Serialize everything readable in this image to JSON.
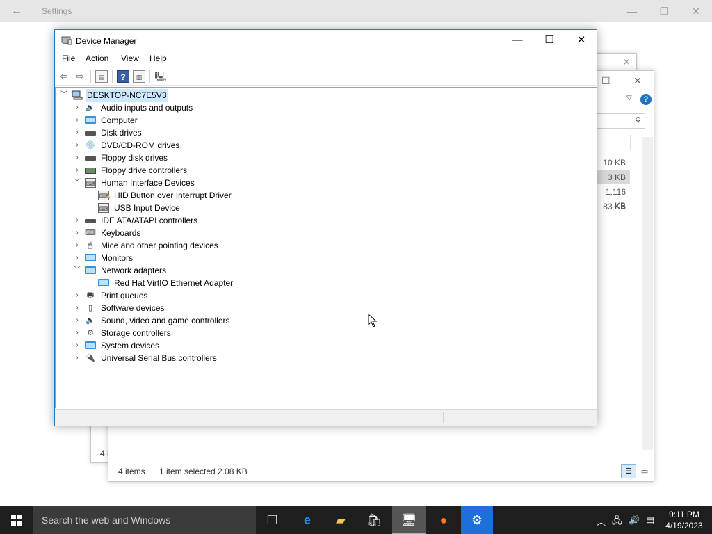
{
  "settings": {
    "title": "Settings"
  },
  "back_window": {
    "corner_text": "4 i"
  },
  "explorer": {
    "sizes": [
      "10 KB",
      "3 KB",
      "1,116 KB",
      "83 KB"
    ],
    "status_items": "4 items",
    "status_selected": "1 item selected  2.08 KB",
    "help_glyph": "?"
  },
  "device_manager": {
    "title": "Device Manager",
    "menu": [
      "File",
      "Action",
      "View",
      "Help"
    ],
    "root": "DESKTOP-NC7E5V3",
    "tree": [
      {
        "label": "Audio inputs and outputs",
        "icon": "speaker-icon",
        "expanded": false,
        "level": 1
      },
      {
        "label": "Computer",
        "icon": "monitor-icon",
        "expanded": false,
        "level": 1
      },
      {
        "label": "Disk drives",
        "icon": "disk-drive-icon",
        "expanded": false,
        "level": 1
      },
      {
        "label": "DVD/CD-ROM drives",
        "icon": "dvd-drive-icon",
        "expanded": false,
        "level": 1
      },
      {
        "label": "Floppy disk drives",
        "icon": "floppy-disk-icon",
        "expanded": false,
        "level": 1
      },
      {
        "label": "Floppy drive controllers",
        "icon": "controller-card-icon",
        "expanded": false,
        "level": 1
      },
      {
        "label": "Human Interface Devices",
        "icon": "hid-icon",
        "expanded": true,
        "level": 1
      },
      {
        "label": "HID Button over Interrupt Driver",
        "icon": "hid-warning-icon",
        "level": 2
      },
      {
        "label": "USB Input Device",
        "icon": "hid-icon",
        "level": 2
      },
      {
        "label": "IDE ATA/ATAPI controllers",
        "icon": "ide-controller-icon",
        "expanded": false,
        "level": 1
      },
      {
        "label": "Keyboards",
        "icon": "keyboard-icon",
        "expanded": false,
        "level": 1
      },
      {
        "label": "Mice and other pointing devices",
        "icon": "mouse-icon",
        "expanded": false,
        "level": 1
      },
      {
        "label": "Monitors",
        "icon": "monitor-icon",
        "expanded": false,
        "level": 1
      },
      {
        "label": "Network adapters",
        "icon": "network-adapter-icon",
        "expanded": true,
        "level": 1
      },
      {
        "label": "Red Hat VirtIO Ethernet Adapter",
        "icon": "network-adapter-icon",
        "level": 2
      },
      {
        "label": "Print queues",
        "icon": "printer-icon",
        "expanded": false,
        "level": 1
      },
      {
        "label": "Software devices",
        "icon": "software-device-icon",
        "expanded": false,
        "level": 1
      },
      {
        "label": "Sound, video and game controllers",
        "icon": "speaker-icon",
        "expanded": false,
        "level": 1
      },
      {
        "label": "Storage controllers",
        "icon": "storage-controller-icon",
        "expanded": false,
        "level": 1
      },
      {
        "label": "System devices",
        "icon": "monitor-icon",
        "expanded": false,
        "level": 1
      },
      {
        "label": "Universal Serial Bus controllers",
        "icon": "usb-icon",
        "expanded": false,
        "level": 1
      }
    ]
  },
  "taskbar": {
    "search_placeholder": "Search the web and Windows",
    "time": "9:11 PM",
    "date": "4/19/2023"
  }
}
